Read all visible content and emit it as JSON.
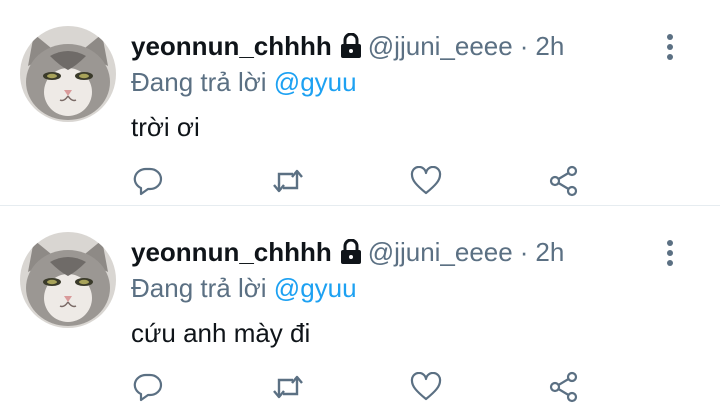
{
  "tweets": [
    {
      "display_name": "yeonnun_chhhh",
      "handle": "@jjuni_eeee",
      "separator": "·",
      "time": "2h",
      "reply_prefix": "Đang trả lời",
      "reply_mention": "@gyuu",
      "text": "trời ơi",
      "avatar_icon": "cat-avatar",
      "lock_icon": "lock-icon"
    },
    {
      "display_name": "yeonnun_chhhh",
      "handle": "@jjuni_eeee",
      "separator": "·",
      "time": "2h",
      "reply_prefix": "Đang trả lời",
      "reply_mention": "@gyuu",
      "text": "cứu anh mày đi",
      "avatar_icon": "cat-avatar",
      "lock_icon": "lock-icon"
    }
  ],
  "action_icons": [
    "reply-icon",
    "retweet-icon",
    "like-icon",
    "share-icon"
  ],
  "colors": {
    "text_primary": "#0f1419",
    "text_secondary": "#5b7083",
    "mention": "#1da1f2",
    "divider": "#e6ecf0"
  }
}
